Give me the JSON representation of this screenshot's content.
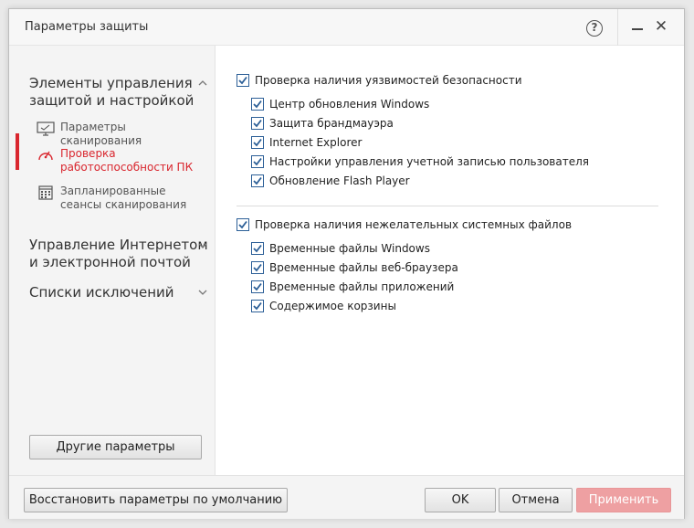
{
  "window": {
    "title": "Параметры защиты",
    "help_label": "?",
    "close_glyph": "✕"
  },
  "sidebar": {
    "groups": [
      {
        "label": "Элементы управления защитой и настройкой",
        "chevron": "up"
      },
      {
        "label": "Управление Интернетом и электронной почтой",
        "chevron": "down"
      },
      {
        "label": "Списки исключений",
        "chevron": "down"
      }
    ],
    "items": [
      {
        "label": "Параметры сканирования",
        "icon": "monitor-icon",
        "active": false
      },
      {
        "label": "Проверка работоспособности ПК",
        "icon": "gauge-icon",
        "active": true
      },
      {
        "label": "Запланированные сеансы сканирования",
        "icon": "calendar-icon",
        "active": false
      }
    ],
    "other_button": "Другие параметры"
  },
  "content": {
    "sections": [
      {
        "label": "Проверка наличия уязвимостей безопасности",
        "checked": true,
        "items": [
          {
            "label": "Центр обновления Windows",
            "checked": true
          },
          {
            "label": "Защита брандмауэра",
            "checked": true
          },
          {
            "label": "Internet Explorer",
            "checked": true
          },
          {
            "label": "Настройки управления учетной записью пользователя",
            "checked": true
          },
          {
            "label": "Обновление Flash Player",
            "checked": true
          }
        ]
      },
      {
        "label": "Проверка наличия нежелательных системных файлов",
        "checked": true,
        "items": [
          {
            "label": "Временные файлы Windows",
            "checked": true
          },
          {
            "label": "Временные файлы веб-браузера",
            "checked": true
          },
          {
            "label": "Временные файлы приложений",
            "checked": true
          },
          {
            "label": "Содержимое корзины",
            "checked": true
          }
        ]
      }
    ]
  },
  "footer": {
    "restore_label": "Восстановить параметры по умолчанию",
    "ok_label": "OK",
    "cancel_label": "Отмена",
    "apply_label": "Применить"
  },
  "colors": {
    "accent_red": "#d9262e",
    "checkbox_blue": "#2c5f97",
    "apply_disabled": "#eea0a2"
  }
}
